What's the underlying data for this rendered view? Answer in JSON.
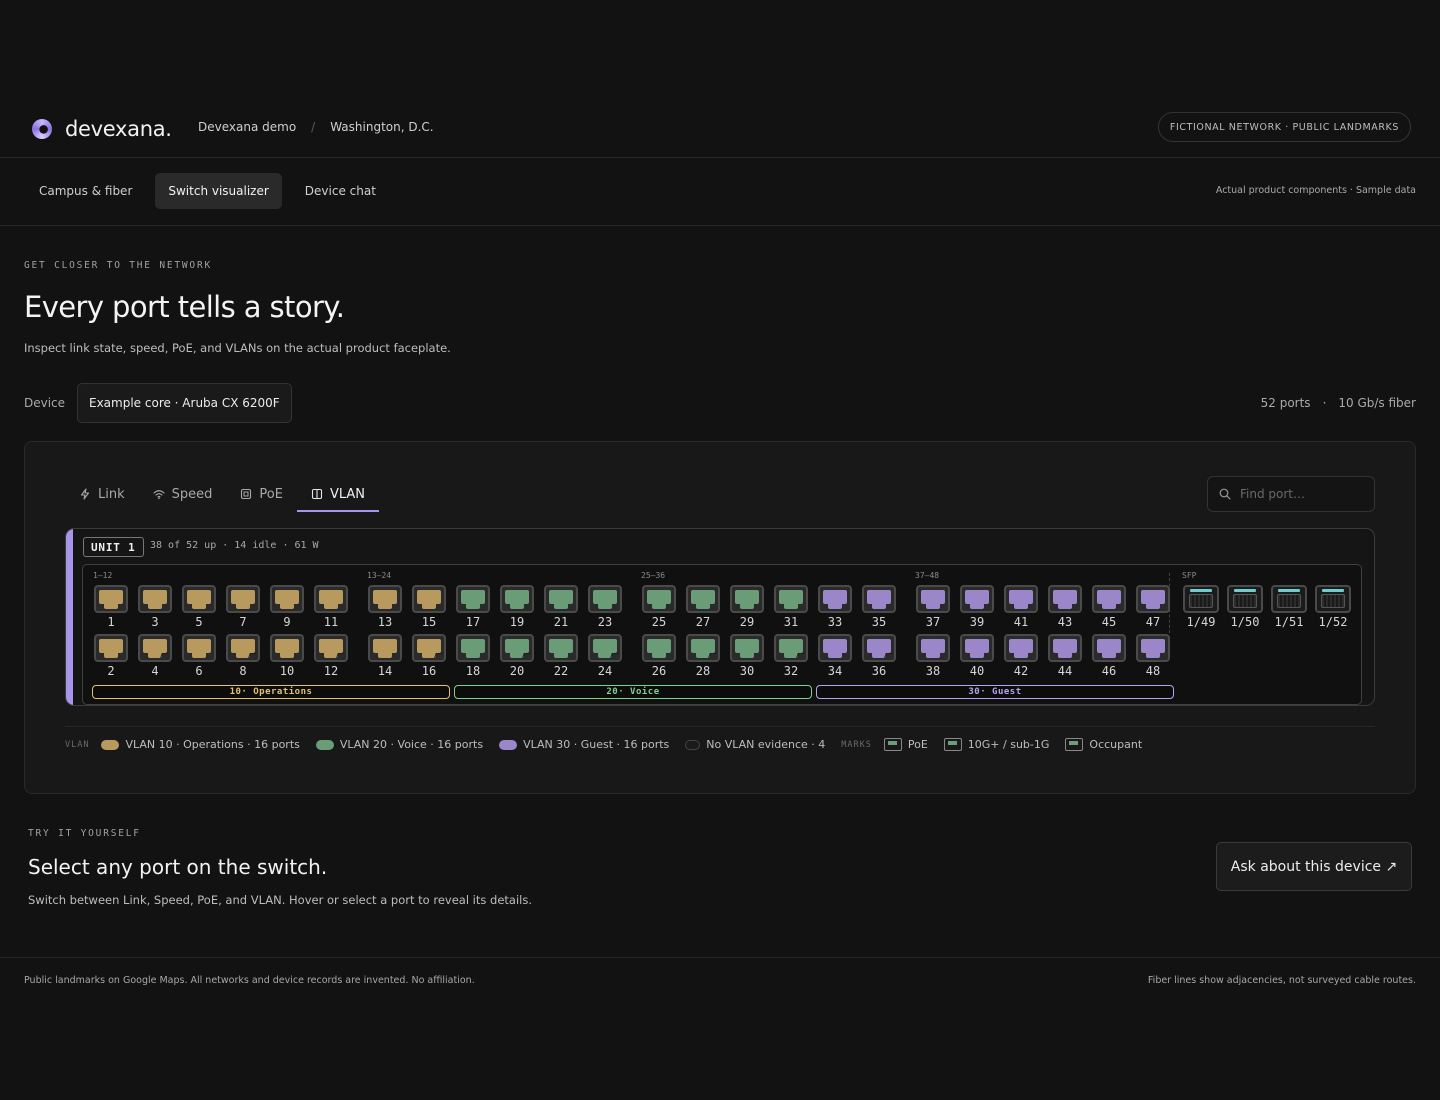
{
  "brand": {
    "name": "devexana."
  },
  "breadcrumb": [
    "Devexana demo",
    "Washington, D.C."
  ],
  "header_badge": "FICTIONAL NETWORK · PUBLIC LANDMARKS",
  "nav": {
    "tabs": [
      "Campus & fiber",
      "Switch visualizer",
      "Device chat"
    ],
    "active": 1,
    "note": "Actual product components · Sample data"
  },
  "hero": {
    "eyebrow": "GET CLOSER TO THE NETWORK",
    "title": "Every port tells a story.",
    "subtitle": "Inspect link state, speed, PoE, and VLANs on the actual product faceplate."
  },
  "device": {
    "label": "Device",
    "selected": "Example core · Aruba CX 6200F",
    "ports": "52 ports",
    "sep": "·",
    "fiber": "10 Gb/s fiber"
  },
  "panel": {
    "modes": [
      "Link",
      "Speed",
      "PoE",
      "VLAN"
    ],
    "active_mode": 3,
    "search_placeholder": "Find port…",
    "unit": {
      "label": "UNIT 1",
      "stats": "38 of 52 up · 14 idle · 61 W"
    },
    "groups": [
      "1–12",
      "13–24",
      "25–36",
      "37–48",
      "SFP"
    ],
    "sfp_ports": [
      "1/49",
      "1/50",
      "1/51",
      "1/52"
    ],
    "vlans": {
      "10": {
        "name": "10· Operations",
        "fill": "#b99a5e",
        "stroke": "#7a6338",
        "band": "#e2c36a"
      },
      "20": {
        "name": "20· Voice",
        "fill": "#6a9c78",
        "stroke": "#456b50",
        "band": "#7fcf8f"
      },
      "30": {
        "name": "30· Guest",
        "fill": "#9a86c8",
        "stroke": "#66578e",
        "band": "#b5a4ec"
      }
    },
    "ports": [
      {
        "n": 1,
        "v": "10",
        "m": false
      },
      {
        "n": 2,
        "v": "10",
        "m": false
      },
      {
        "n": 3,
        "v": "10",
        "m": false
      },
      {
        "n": 4,
        "v": "10",
        "m": true
      },
      {
        "n": 5,
        "v": "10",
        "m": false
      },
      {
        "n": 6,
        "v": "10",
        "m": false
      },
      {
        "n": 7,
        "v": "10",
        "m": false
      },
      {
        "n": 8,
        "v": "10",
        "m": true
      },
      {
        "n": 9,
        "v": "10",
        "m": false
      },
      {
        "n": 10,
        "v": "10",
        "m": false
      },
      {
        "n": 11,
        "v": "10",
        "m": false
      },
      {
        "n": 12,
        "v": "10",
        "m": true
      },
      {
        "n": 13,
        "v": "10",
        "m": false
      },
      {
        "n": 14,
        "v": "10",
        "m": false
      },
      {
        "n": 15,
        "v": "10",
        "m": false
      },
      {
        "n": 16,
        "v": "10",
        "m": true
      },
      {
        "n": 17,
        "v": "20",
        "m": false
      },
      {
        "n": 18,
        "v": "20",
        "m": false
      },
      {
        "n": 19,
        "v": "20",
        "m": false
      },
      {
        "n": 20,
        "v": "20",
        "m": true
      },
      {
        "n": 21,
        "v": "20",
        "m": false
      },
      {
        "n": 22,
        "v": "20",
        "m": false
      },
      {
        "n": 23,
        "v": "20",
        "m": false
      },
      {
        "n": 24,
        "v": "20",
        "m": true
      },
      {
        "n": 25,
        "v": "20",
        "m": false
      },
      {
        "n": 26,
        "v": "20",
        "m": false
      },
      {
        "n": 27,
        "v": "20",
        "m": false
      },
      {
        "n": 28,
        "v": "20",
        "m": true
      },
      {
        "n": 29,
        "v": "20",
        "m": false
      },
      {
        "n": 30,
        "v": "20",
        "m": false
      },
      {
        "n": 31,
        "v": "20",
        "m": false
      },
      {
        "n": 32,
        "v": "20",
        "m": true
      },
      {
        "n": 33,
        "v": "30",
        "m": false
      },
      {
        "n": 34,
        "v": "30",
        "m": false
      },
      {
        "n": 35,
        "v": "30",
        "m": false
      },
      {
        "n": 36,
        "v": "30",
        "m": true
      },
      {
        "n": 37,
        "v": "30",
        "m": false
      },
      {
        "n": 38,
        "v": "30",
        "m": false
      },
      {
        "n": 39,
        "v": "30",
        "m": false
      },
      {
        "n": 40,
        "v": "30",
        "m": false
      },
      {
        "n": 41,
        "v": "30",
        "m": false
      },
      {
        "n": 42,
        "v": "30",
        "m": false
      },
      {
        "n": 43,
        "v": "30",
        "m": false
      },
      {
        "n": 44,
        "v": "30",
        "m": false
      },
      {
        "n": 45,
        "v": "30",
        "m": false
      },
      {
        "n": 46,
        "v": "30",
        "m": false
      },
      {
        "n": 47,
        "v": "30",
        "m": false
      },
      {
        "n": 48,
        "v": "30",
        "m": false
      }
    ],
    "legend": {
      "vlan_tag": "VLAN",
      "vlan10": "VLAN 10 · Operations · 16 ports",
      "vlan20": "VLAN 20 · Voice · 16 ports",
      "vlan30": "VLAN 30 · Guest · 16 ports",
      "none": "No VLAN evidence · 4",
      "marks_tag": "MARKS",
      "poe": "PoE",
      "speed": "10G+ / sub-1G",
      "occupant": "Occupant"
    }
  },
  "try": {
    "eyebrow": "TRY IT YOURSELF",
    "title": "Select any port on the switch.",
    "subtitle": "Switch between Link, Speed, PoE, and VLAN. Hover or select a port to reveal its details.",
    "button": "Ask about this device ↗"
  },
  "footer": {
    "left": "Public landmarks on Google Maps. All networks and device records are invented. No affiliation.",
    "right": "Fiber lines show adjacencies, not surveyed cable routes."
  }
}
